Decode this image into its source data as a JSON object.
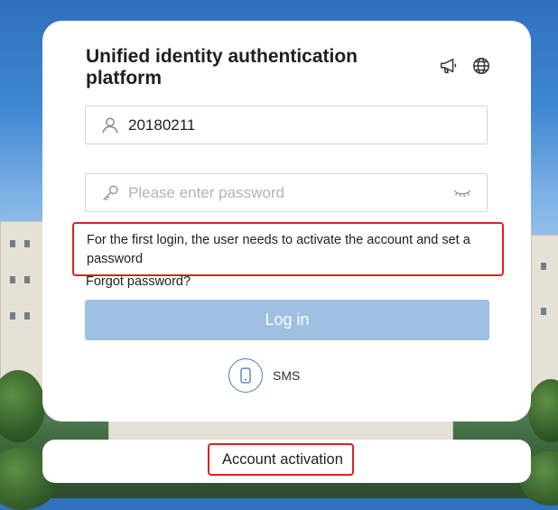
{
  "title": "Unified identity authentication platform",
  "top_icons": [
    "announcement-icon",
    "globe-icon"
  ],
  "username": {
    "icon": "user-icon",
    "value": "20180211"
  },
  "password": {
    "icon": "key-icon",
    "placeholder": "Please enter password",
    "toggle_icon": "eye-closed-icon"
  },
  "notice": "For the first login, the user needs to activate the account and set a password",
  "forgot_password": "Forgot password?",
  "login_button": "Log in",
  "sms": {
    "icon": "phone-icon",
    "label": "SMS"
  },
  "account_activation": "Account activation",
  "colors": {
    "login_button": "#9fbfe3",
    "highlight_border": "#e02020",
    "sms_icon": "#4a7fc1"
  }
}
